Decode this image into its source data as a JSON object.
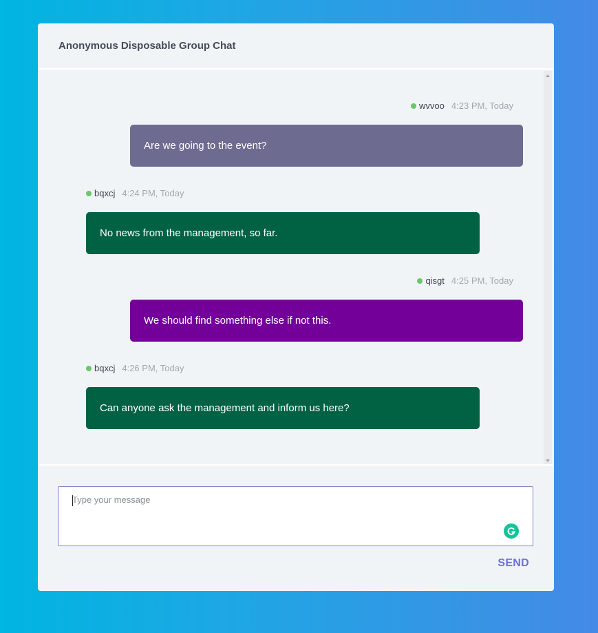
{
  "header": {
    "title": "Anonymous Disposable Group Chat"
  },
  "messages": [
    {
      "user": "wvvoo",
      "time": "4:23 PM, Today",
      "text": "Are we going to the event?",
      "align": "right",
      "color": "#6e6b91"
    },
    {
      "user": "bqxcj",
      "time": "4:24 PM, Today",
      "text": "No news from the management, so far.",
      "align": "left",
      "color": "#006243"
    },
    {
      "user": "qisgt",
      "time": "4:25 PM, Today",
      "text": "We should find something else if not this.",
      "align": "right",
      "color": "#720099"
    },
    {
      "user": "bqxcj",
      "time": "4:26 PM, Today",
      "text": "Can anyone ask the management and inform us here?",
      "align": "left",
      "color": "#006243"
    }
  ],
  "composer": {
    "placeholder": "Type your message",
    "value": "",
    "send_label": "SEND",
    "assistant_icon": "grammarly-icon"
  },
  "colors": {
    "online": "#6cc76a",
    "send": "#6b6fd6",
    "input_border": "#7a82c2"
  }
}
